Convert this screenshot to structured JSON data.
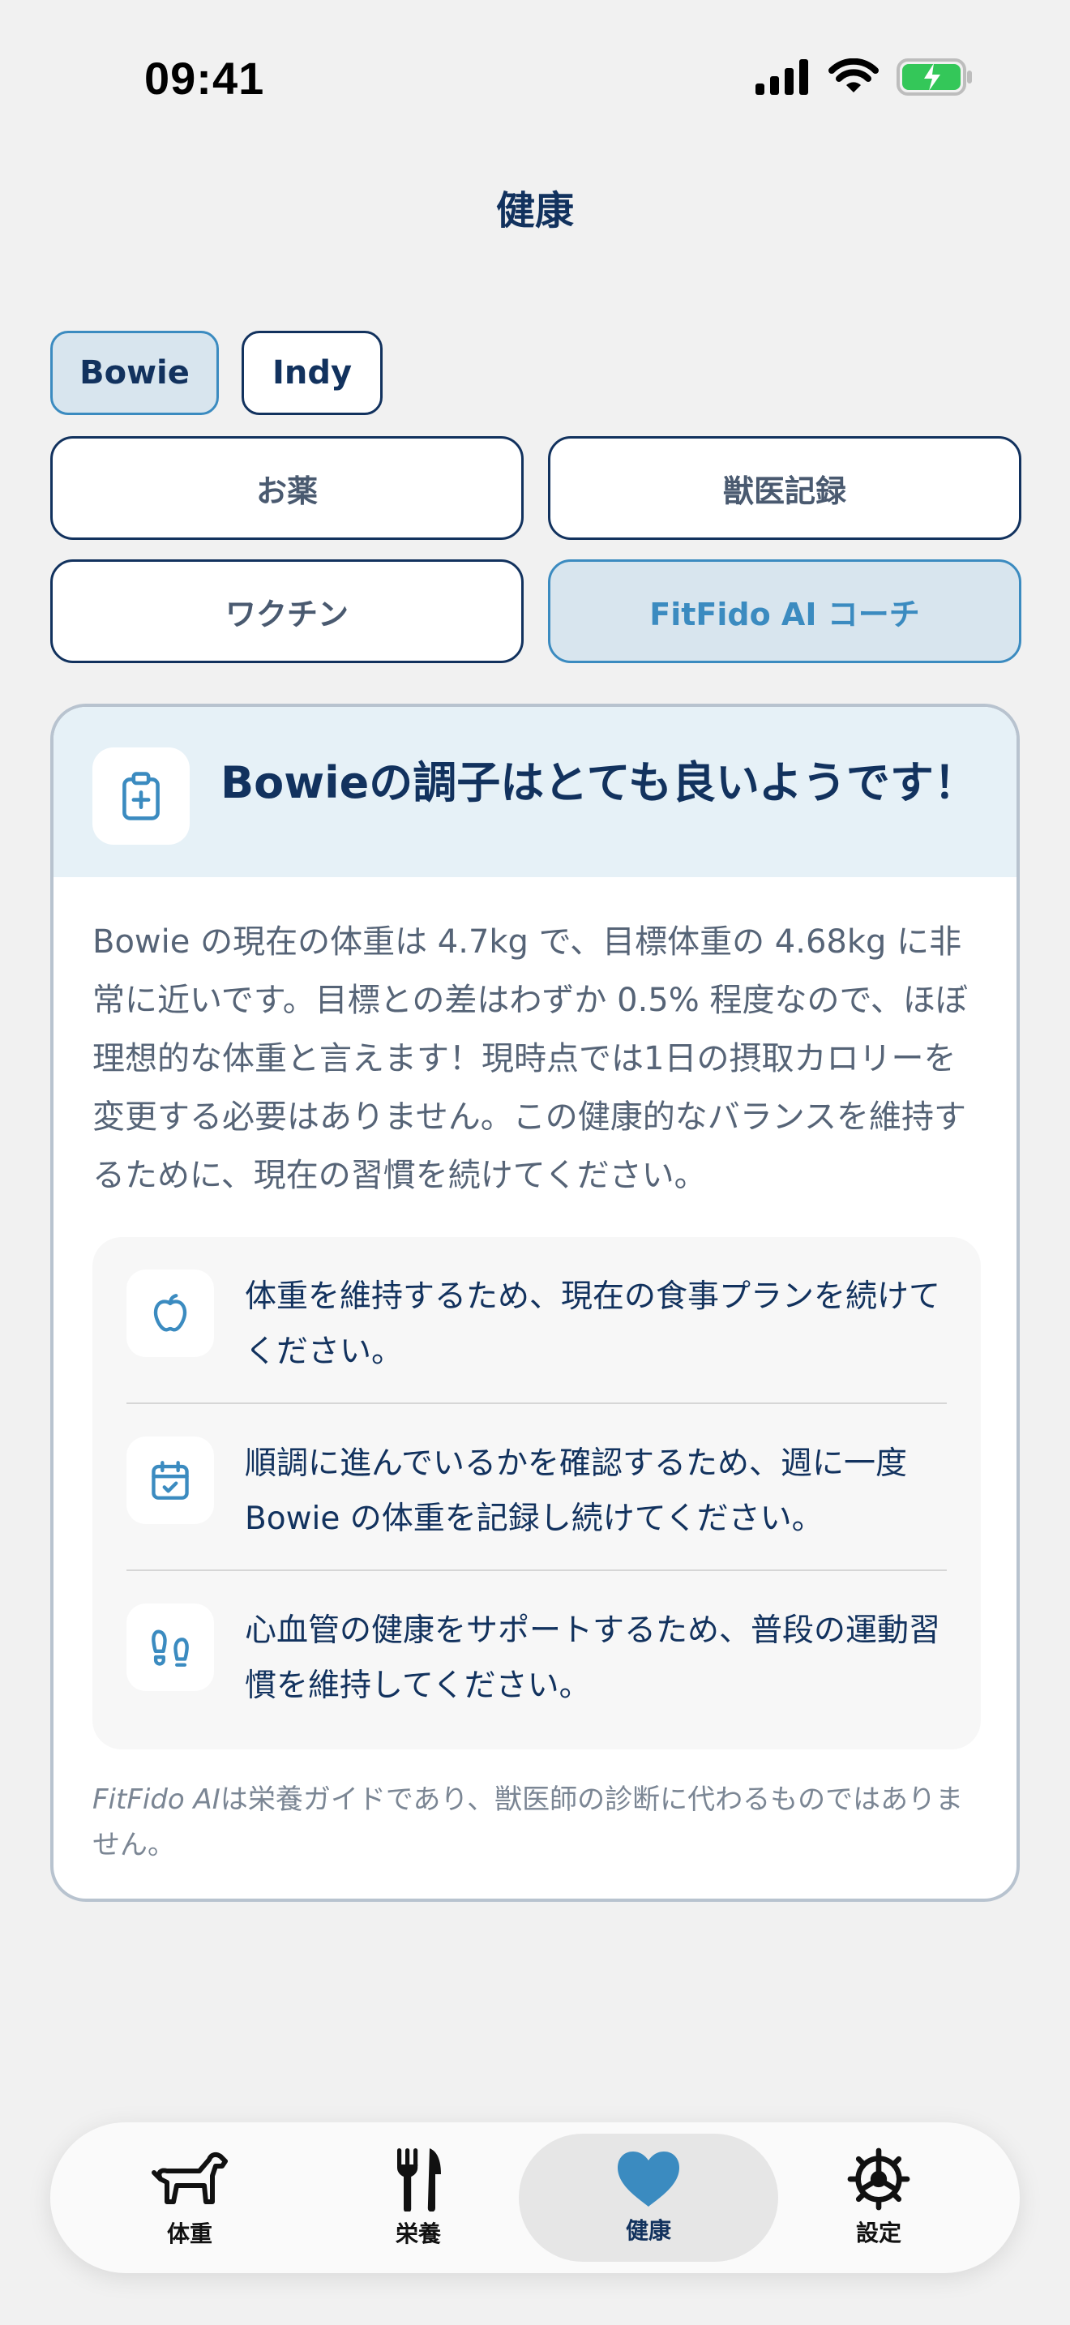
{
  "status_bar": {
    "time": "09:41"
  },
  "header": {
    "title": "健康"
  },
  "pets": [
    {
      "name": "Bowie",
      "selected": true
    },
    {
      "name": "Indy",
      "selected": false
    }
  ],
  "segments": [
    {
      "label": "お薬",
      "selected": false
    },
    {
      "label": "獣医記録",
      "selected": false
    },
    {
      "label": "ワクチン",
      "selected": false
    },
    {
      "label": "FitFido AI コーチ",
      "selected": true
    }
  ],
  "coach_card": {
    "icon": "clipboard-plus-icon",
    "title": "Bowieの調子はとても良いようです！",
    "body": "Bowie の現在の体重は 4.7kg で、目標体重の 4.68kg に非常に近いです。目標との差はわずか 0.5% 程度なので、ほぼ理想的な体重と言えます！現時点では1日の摂取カロリーを変更する必要はありません。この健康的なバランスを維持するために、現在の習慣を続けてください。",
    "tips": [
      {
        "icon": "apple-icon",
        "text": "体重を維持するため、現在の食事プランを続けてください。"
      },
      {
        "icon": "calendar-check-icon",
        "text": "順調に進んでいるかを確認するため、週に一度 Bowie の体重を記録し続けてください。"
      },
      {
        "icon": "footprints-icon",
        "text": "心血管の健康をサポートするため、普段の運動習慣を維持してください。"
      }
    ],
    "disclaimer_brand": "FitFido AI",
    "disclaimer_text": "は栄養ガイドであり、獣医師の診断に代わるものではありません。"
  },
  "tab_bar": {
    "tabs": [
      {
        "label": "体重",
        "icon": "dog-icon",
        "selected": false
      },
      {
        "label": "栄養",
        "icon": "fork-knife-icon",
        "selected": false
      },
      {
        "label": "健康",
        "icon": "heart-icon",
        "selected": true
      },
      {
        "label": "設定",
        "icon": "gear-icon",
        "selected": false
      }
    ]
  },
  "colors": {
    "primary": "#12325e",
    "accent": "#3b8bc0",
    "selected_bg": "#d8e5ee",
    "card_header_bg": "#e6f1f7",
    "battery_green": "#34c759"
  }
}
